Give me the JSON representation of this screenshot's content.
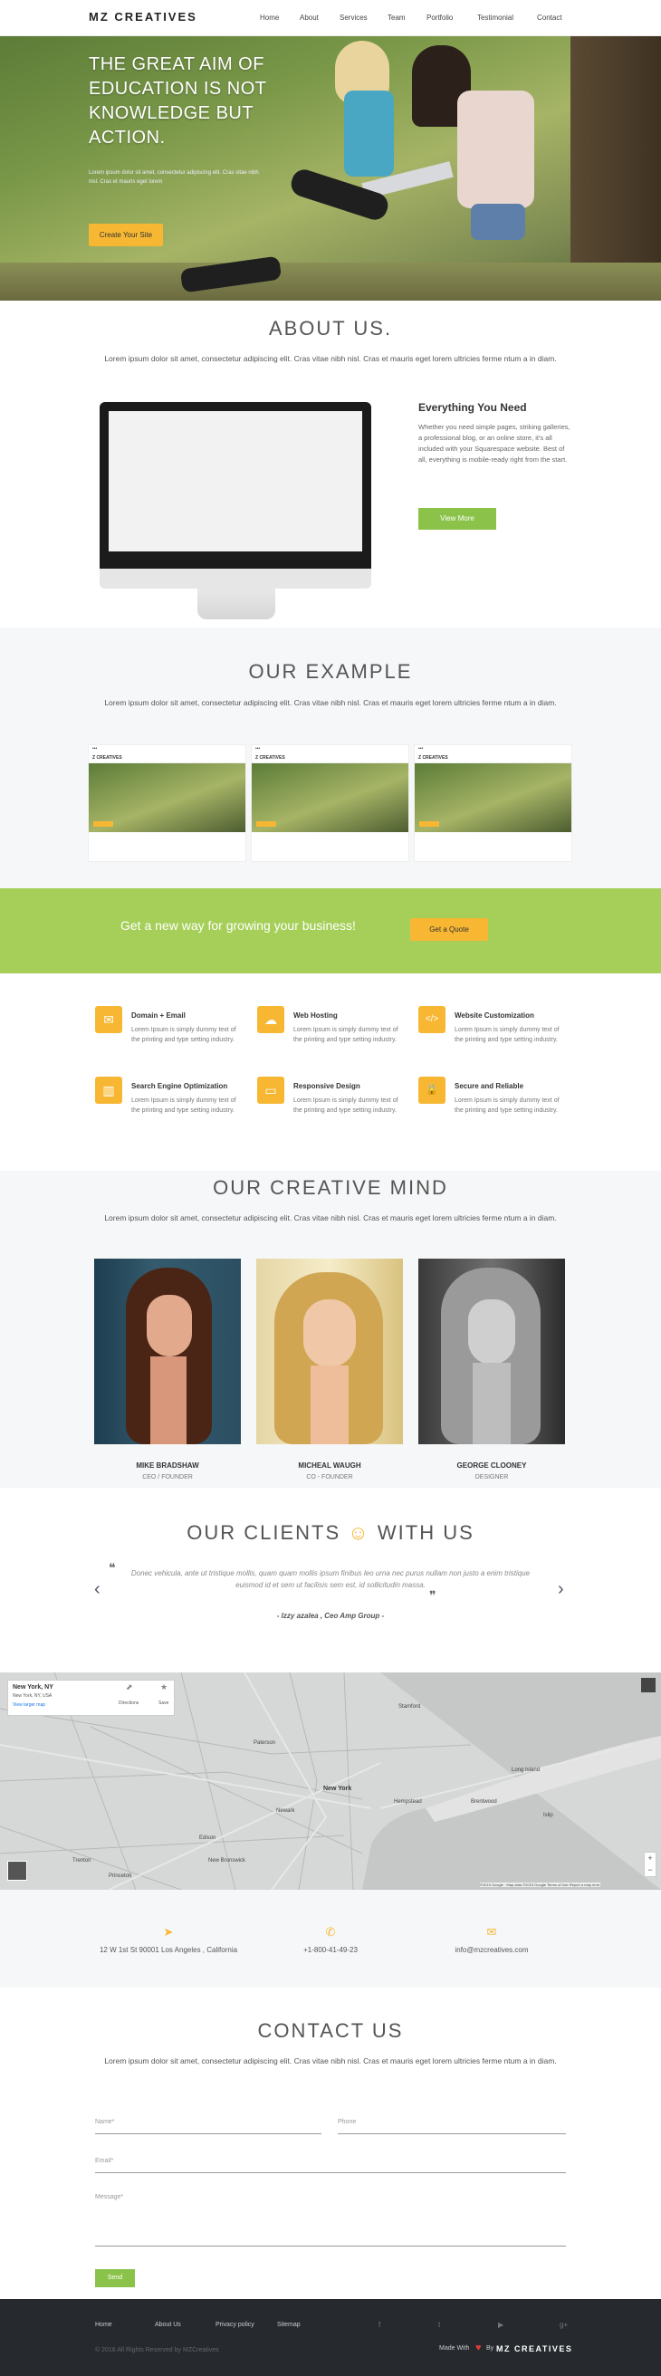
{
  "nav": {
    "brand": "MZ CREATIVES",
    "links": [
      "Home",
      "About",
      "Services",
      "Team",
      "Portfolio",
      "Testimonial",
      "Contact"
    ]
  },
  "hero": {
    "title": "THE GREAT AIM OF EDUCATION IS NOT KNOWLEDGE BUT ACTION.",
    "subtitle": "Lorem ipsum dolor sit amet, consectetur adipiscing elit. Cras vitae nibh nisl. Cras et mauris eget lorem",
    "button": "Create Your Site"
  },
  "about": {
    "title": "ABOUT US.",
    "intro": "Lorem ipsum dolor sit amet, consectetur adipiscing elit. Cras vitae nibh nisl. Cras et mauris eget lorem ultricies ferme ntum a in diam.",
    "heading": "Everything You Need",
    "body": "Whether you need simple pages, striking galleries, a professional blog, or an online store, it's all included with your Squarespace website. Best of all, everything is mobile-ready right from the start.",
    "button": "View More"
  },
  "example": {
    "title": "OUR EXAMPLE",
    "intro": "Lorem ipsum dolor sit amet, consectetur adipiscing elit. Cras vitae nibh nisl. Cras et mauris eget lorem ultricies ferme ntum a in diam.",
    "thumb_brand": "Z CREATIVES"
  },
  "banner": {
    "text": "Get a new way for growing your business!",
    "button": "Get a Quote"
  },
  "features": [
    {
      "icon": "mail-icon",
      "glyph": "✉",
      "title": "Domain + Email",
      "text": "Lorem Ipsum is simply dummy text of the printing and type setting industry."
    },
    {
      "icon": "cloud-icon",
      "glyph": "☁",
      "title": "Web Hosting",
      "text": "Lorem Ipsum is simply dummy text of the printing and type setting industry."
    },
    {
      "icon": "code-icon",
      "glyph": "</>",
      "title": "Website Customization",
      "text": "Lorem Ipsum is simply dummy text of the printing and type setting industry."
    },
    {
      "icon": "chart-icon",
      "glyph": "▥",
      "title": "Search Engine Optimization",
      "text": "Lorem Ipsum is simply dummy text of the printing and type setting industry."
    },
    {
      "icon": "monitor-icon",
      "glyph": "▭",
      "title": "Responsive Design",
      "text": "Lorem Ipsum is simply dummy text of the printing and type setting industry."
    },
    {
      "icon": "lock-icon",
      "glyph": "🔒",
      "title": "Secure and Reliable",
      "text": "Lorem Ipsum is simply dummy text of the printing and type setting industry."
    }
  ],
  "team": {
    "title": "OUR CREATIVE MIND",
    "intro": "Lorem ipsum dolor sit amet, consectetur adipiscing elit. Cras vitae nibh nisl. Cras et mauris eget lorem ultricies ferme ntum a in diam.",
    "members": [
      {
        "name": "MIKE BRADSHAW",
        "role": "CEO / FOUNDER"
      },
      {
        "name": "MICHEAL WAUGH",
        "role": "CO - FOUNDER"
      },
      {
        "name": "GEORGE CLOONEY",
        "role": "DESIGNER"
      }
    ]
  },
  "clients": {
    "title_left": "OUR CLIENTS",
    "smiley": "☺",
    "title_right": "WITH US",
    "quote": "Donec vehicula, ante ut tristique mollis, quam quam mollis ipsum finibus leo urna nec purus nullam non justo a enim tristique euismod id et sem ut facilisis sem est, id sollicitudin massa.",
    "author": "- Izzy azalea , Ceo Amp Group -",
    "open_quote": "❝",
    "close_quote": "❞"
  },
  "map": {
    "place": "New York, NY",
    "place_sub": "New York, NY, USA",
    "larger": "View larger map",
    "directions": "Directions",
    "save": "Save",
    "footer": "©2015 Google · Map data ©2015 Google   Terms of Use   Report a map error",
    "labels": [
      "New York",
      "Newark",
      "Long Island",
      "Paterson",
      "Stamford",
      "Edison",
      "Princeton",
      "Brentwood",
      "Hempstead",
      "New Brunswick",
      "Trenton",
      "Islip"
    ]
  },
  "contact_info": {
    "address": "12 W 1st St 90001 Los Angeles , California",
    "phone": "+1-800-41-49-23",
    "email": "info@mzcreatives.com"
  },
  "contact": {
    "title": "CONTACT US",
    "intro": "Lorem ipsum dolor sit amet, consectetur adipiscing elit. Cras vitae nibh nisl. Cras et mauris eget lorem ultricies ferme ntum a in diam.",
    "name_label": "Name*",
    "phone_label": "Phone",
    "email_label": "Email*",
    "message_label": "Message*",
    "send": "Send"
  },
  "footer": {
    "links": [
      "Home",
      "About Us",
      "Privacy policy",
      "Sitemap"
    ],
    "social": [
      "f",
      "t",
      "▶",
      "g+"
    ],
    "copyright": "© 2016 All Rights Reserved by MZCreatives",
    "made_with": "Made With",
    "by": "By",
    "brand": "MZ CREATIVES"
  }
}
